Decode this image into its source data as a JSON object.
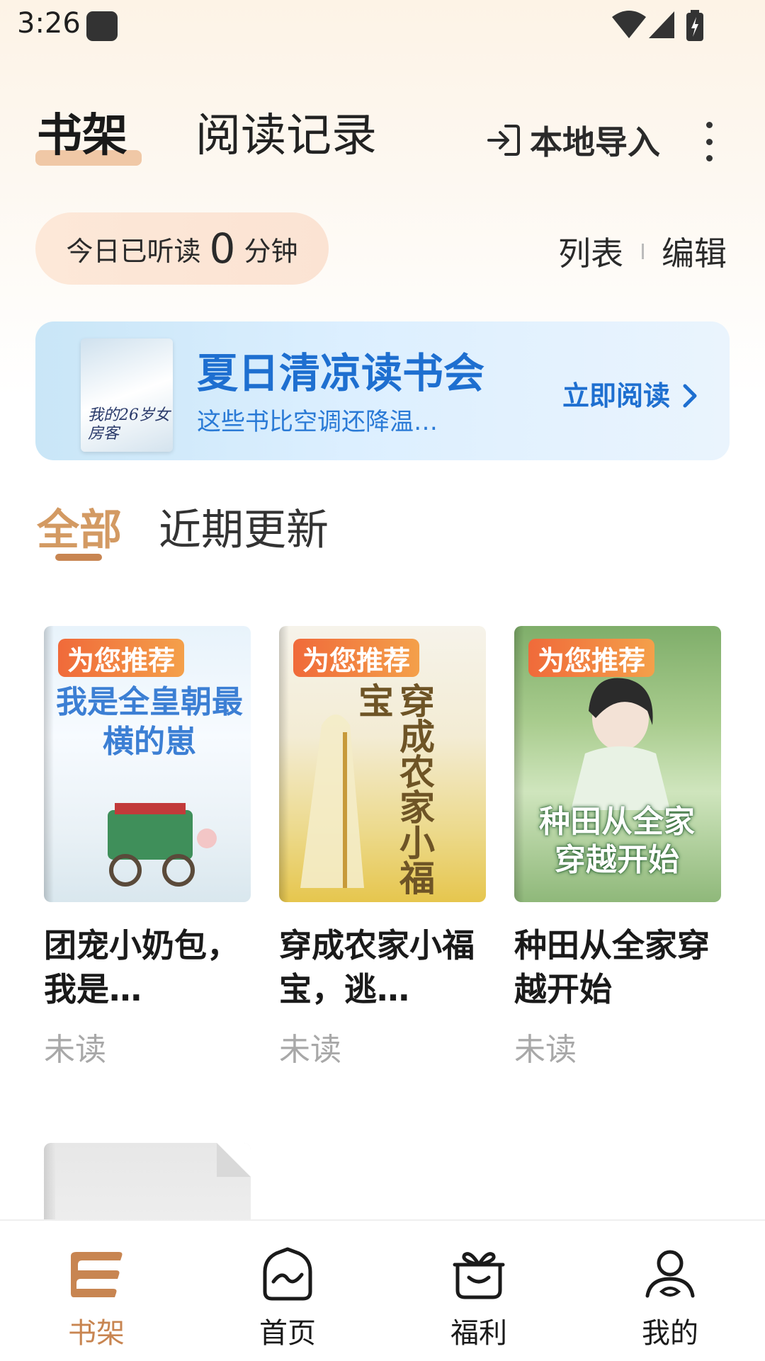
{
  "status_bar": {
    "time": "3:26"
  },
  "header": {
    "tab_shelf": "书架",
    "tab_history": "阅读记录",
    "import_label": "本地导入"
  },
  "reading_stats": {
    "prefix": "今日已听读",
    "minutes": "0",
    "suffix": "分钟"
  },
  "view_controls": {
    "list": "列表",
    "edit": "编辑"
  },
  "banner": {
    "title": "夏日清凉读书会",
    "subtitle": "这些书比空调还降温…",
    "cta": "立即阅读",
    "cover_text": "我的26岁女房客"
  },
  "filter_tabs": {
    "all": "全部",
    "recent": "近期更新"
  },
  "books": [
    {
      "badge": "为您推荐",
      "cover_text": "我是全皇朝最横的崽",
      "title": "团宠小奶包，我是…",
      "status": "未读",
      "accent": "#3c7fd4"
    },
    {
      "badge": "为您推荐",
      "cover_text": "穿成农家小福宝",
      "title": "穿成农家小福宝，逃…",
      "status": "未读",
      "accent": "#8a6a2e"
    },
    {
      "badge": "为您推荐",
      "cover_text": "种田从全家穿越开始",
      "title": "种田从全家穿越开始",
      "status": "未读",
      "accent": "#2f7a3a"
    }
  ],
  "bottom_nav": [
    {
      "label": "书架",
      "icon": "bookshelf-icon",
      "active": true
    },
    {
      "label": "首页",
      "icon": "home-icon",
      "active": false
    },
    {
      "label": "福利",
      "icon": "gift-icon",
      "active": false
    },
    {
      "label": "我的",
      "icon": "profile-icon",
      "active": false
    }
  ],
  "colors": {
    "accent": "#c88551",
    "banner_blue": "#1e6fd0",
    "badge_orange": "#f06a3a"
  }
}
